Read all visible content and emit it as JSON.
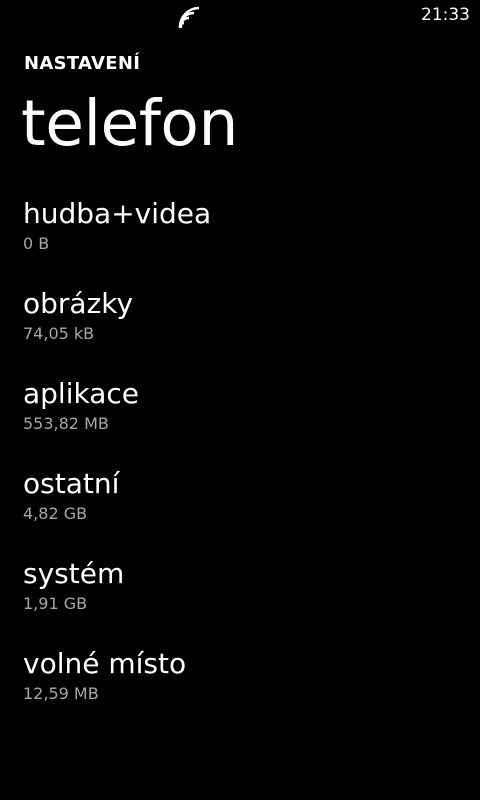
{
  "status_bar": {
    "signal_icon": "wifi-signal-icon",
    "time": "21:33"
  },
  "header": {
    "app_title": "NASTAVENÍ",
    "page_title": "telefon"
  },
  "storage": {
    "items": [
      {
        "label": "hudba+videa",
        "size": "0 B"
      },
      {
        "label": "obrázky",
        "size": "74,05 kB"
      },
      {
        "label": "aplikace",
        "size": "553,82 MB"
      },
      {
        "label": "ostatní",
        "size": "4,82 GB"
      },
      {
        "label": "systém",
        "size": "1,91 GB"
      },
      {
        "label": "volné místo",
        "size": "12,59 MB"
      }
    ]
  },
  "colors": {
    "background": "#000000",
    "primary_text": "#ffffff",
    "secondary_text": "#a6a6a6"
  }
}
